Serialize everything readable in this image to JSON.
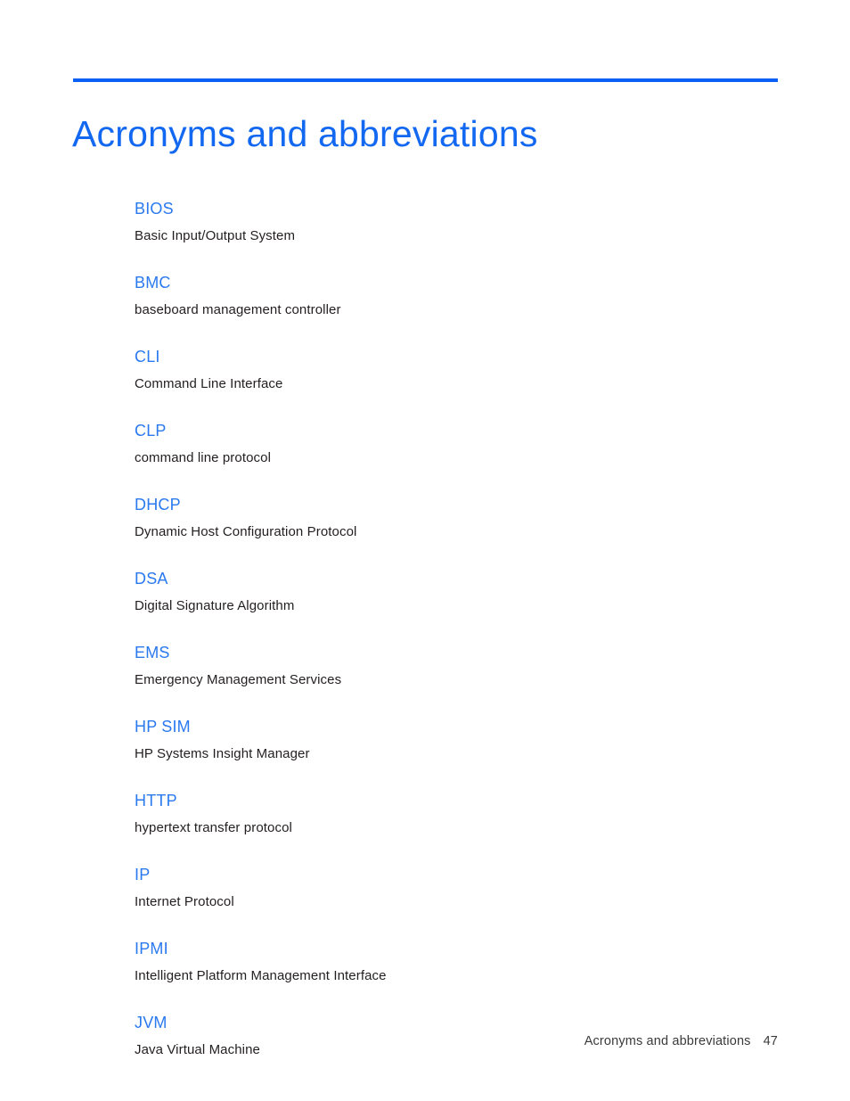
{
  "document": {
    "title": "Acronyms and abbreviations",
    "accent_color": "#0a5ff5",
    "term_color": "#2a79ef",
    "body_color": "#231f20"
  },
  "glossary": {
    "entries": [
      {
        "term": "BIOS",
        "definition": "Basic Input/Output System"
      },
      {
        "term": "BMC",
        "definition": "baseboard management controller"
      },
      {
        "term": "CLI",
        "definition": "Command Line Interface"
      },
      {
        "term": "CLP",
        "definition": "command line protocol"
      },
      {
        "term": "DHCP",
        "definition": "Dynamic Host Configuration Protocol"
      },
      {
        "term": "DSA",
        "definition": "Digital Signature Algorithm"
      },
      {
        "term": "EMS",
        "definition": "Emergency Management Services"
      },
      {
        "term": "HP SIM",
        "definition": "HP Systems Insight Manager"
      },
      {
        "term": "HTTP",
        "definition": "hypertext transfer protocol"
      },
      {
        "term": "IP",
        "definition": "Internet Protocol"
      },
      {
        "term": "IPMI",
        "definition": "Intelligent Platform Management Interface"
      },
      {
        "term": "JVM",
        "definition": "Java Virtual Machine"
      }
    ]
  },
  "footer": {
    "label": "Acronyms and abbreviations",
    "page_number": "47"
  }
}
